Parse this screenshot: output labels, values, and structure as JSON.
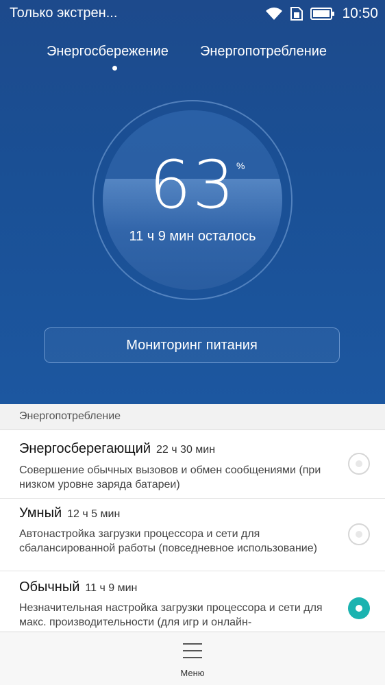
{
  "status_bar": {
    "notification_text": "Только экстрен...",
    "time": "10:50",
    "icons": [
      "wifi-icon",
      "sim-icon",
      "battery-icon"
    ]
  },
  "tabs": [
    {
      "label": "Энергосбережение",
      "selected": true
    },
    {
      "label": "Энергопотребление",
      "selected": false
    }
  ],
  "battery": {
    "percent_value": "63",
    "percent_sign": "%",
    "remaining": "11 ч 9 мин осталось"
  },
  "monitor_button": "Мониторинг питания",
  "section_header": "Энергопотребление",
  "modes": [
    {
      "title": "Энергосберегающий",
      "time": "22 ч 30 мин",
      "description": "Совершение обычных вызовов и обмен сообщениями (при низком уровне заряда батареи)",
      "selected": false
    },
    {
      "title": "Умный",
      "time": "12 ч 5 мин",
      "description": "Автонастройка загрузки процессора и сети для сбалансированной работы (повседневное использование)",
      "selected": false
    },
    {
      "title": "Обычный",
      "time": "11 ч 9 мин",
      "description": "Незначительная настройка загрузки процессора и сети для макс. производительности (для игр и онлайн-",
      "selected": true
    }
  ],
  "bottom_bar": {
    "menu_label": "Меню",
    "menu_icon": "hamburger-icon"
  },
  "colors": {
    "header_blue": "#1c57a0",
    "accent_teal": "#1bb3b0"
  }
}
